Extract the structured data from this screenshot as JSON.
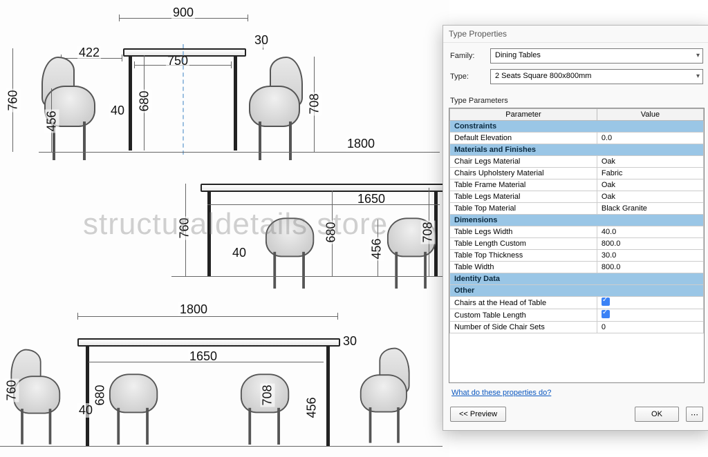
{
  "watermark": "structuraldetails store",
  "drawing": {
    "elev1": {
      "overallW": "900",
      "tableTopW": "750",
      "chairBackW": "422",
      "overallH": "760",
      "seatH": "456",
      "tableH": "680",
      "chairH": "708",
      "horizW": "1800",
      "topThk": "30",
      "legW": "40"
    },
    "elev2": {
      "span": "1650",
      "tableH": "680",
      "seatH": "456",
      "chairH": "708",
      "overallH": "760",
      "legW": "40"
    },
    "elev3": {
      "span": "1800",
      "inner": "1650",
      "tableH": "680",
      "seatH": "456",
      "chairH": "708",
      "overallH": "760",
      "legW": "40",
      "topThk": "30"
    }
  },
  "dialog": {
    "title": "Type Properties",
    "familyLabel": "Family:",
    "familyValue": "Dining Tables",
    "typeLabel": "Type:",
    "typeValue": "2 Seats Square 800x800mm",
    "paramsLabel": "Type Parameters",
    "headers": {
      "param": "Parameter",
      "value": "Value"
    },
    "groups": [
      {
        "name": "Constraints",
        "rows": [
          {
            "p": "Default Elevation",
            "v": "0.0"
          }
        ]
      },
      {
        "name": "Materials and Finishes",
        "rows": [
          {
            "p": "Chair Legs Material",
            "v": "Oak"
          },
          {
            "p": "Chairs Upholstery Material",
            "v": "Fabric"
          },
          {
            "p": "Table Frame Material",
            "v": "Oak"
          },
          {
            "p": "Table Legs Material",
            "v": "Oak"
          },
          {
            "p": "Table Top Material",
            "v": "Black Granite"
          }
        ]
      },
      {
        "name": "Dimensions",
        "rows": [
          {
            "p": "Table Legs Width",
            "v": "40.0"
          },
          {
            "p": "Table Length Custom",
            "v": "800.0"
          },
          {
            "p": "Table Top Thickness",
            "v": "30.0"
          },
          {
            "p": "Table Width",
            "v": "800.0"
          }
        ]
      },
      {
        "name": "Identity Data",
        "rows": []
      },
      {
        "name": "Other",
        "rows": [
          {
            "p": "Chairs at the Head of Table",
            "v": "",
            "check": true
          },
          {
            "p": "Custom Table Length",
            "v": "",
            "check": true
          },
          {
            "p": "Number of Side Chair Sets",
            "v": "0"
          }
        ]
      }
    ],
    "helpLink": "What do these properties do?",
    "buttons": {
      "preview": "<< Preview",
      "ok": "OK"
    }
  }
}
